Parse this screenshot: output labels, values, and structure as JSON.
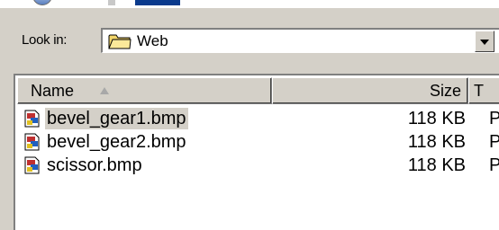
{
  "look_in": {
    "label": "Look in:",
    "value": "Web",
    "icon": "folder-icon"
  },
  "columns": {
    "name": "Name",
    "size": "Size",
    "type": "T"
  },
  "files": [
    {
      "name": "bevel_gear1.bmp",
      "size": "118 KB",
      "type": "P",
      "icon": "bitmap-file-icon",
      "selected": true
    },
    {
      "name": "bevel_gear2.bmp",
      "size": "118 KB",
      "type": "P",
      "icon": "bitmap-file-icon",
      "selected": false
    },
    {
      "name": "scissor.bmp",
      "size": "118 KB",
      "type": "P",
      "icon": "bitmap-file-icon",
      "selected": false
    }
  ],
  "colors": {
    "dialog_bg": "#d4d0c8",
    "list_bg": "#ffffff",
    "selection": "#d4d0c8"
  }
}
